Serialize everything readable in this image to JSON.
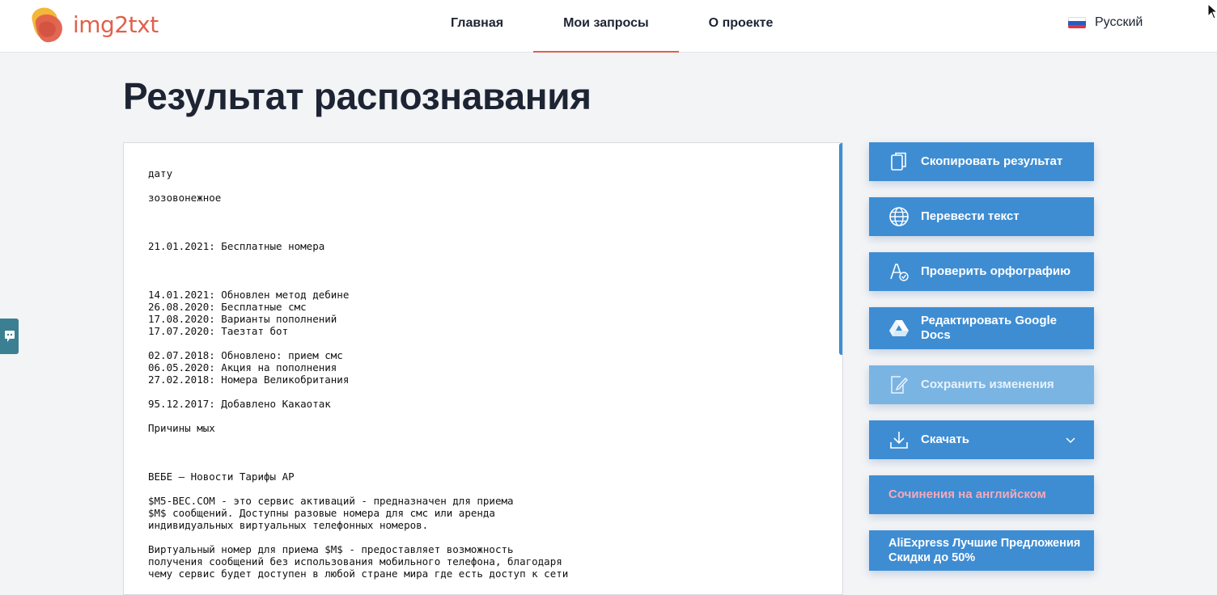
{
  "header": {
    "logo_text": "img2txt",
    "nav": [
      {
        "label": "Главная"
      },
      {
        "label": "Мои запросы"
      },
      {
        "label": "О проекте"
      }
    ],
    "language": "Русский"
  },
  "page": {
    "title": "Результат распознавания"
  },
  "result_text": "дату\n\nзозовонежное\n\n\n\n21.01.2021: Бесплатные номера\n\n\n\n14.01.2021: Обновлен метод дебине\n26.08.2020: Бесплатные смс\n17.08.2020: Варианты пополнений\n17.07.2020: Таезтат бот\n\n02.07.2018: Обновлено: прием смс\n06.05.2020: Акция на пополнения\n27.02.2018: Номера Великобритания\n\n95.12.2017: Добавлено Какаотак\n\nПричины мых\n\n\n\nВЕБЕ — Новости Тарифы АР\n\n$М5-ВЕС.СОМ - это сервис активаций - предназначен для приема\n$М$ сообщений. Доступны разовые номера для смс или аренда\nиндивидуальных виртуальных телефонных номеров.\n\nВиртуальный номер для приема $М$ - предоставляет возможность\nполучения сообщений без использования мобильного телефона, благодаря\nчему сервис будет доступен в любой стране мира где есть доступ к сети",
  "actions": {
    "copy": "Скопировать результат",
    "translate": "Перевести текст",
    "spellcheck": "Проверить орфографию",
    "google_docs": "Редактировать Google Docs",
    "save": "Сохранить изменения",
    "download": "Скачать",
    "ad1": "Сочинения на английском",
    "ad2": "AliExpress Лучшие Предложения Скидки до 50%"
  },
  "colors": {
    "accent": "#e0604c",
    "button": "#3e8dd3",
    "button_disabled": "#7ab4e2",
    "ad1_text": "#f6a9b8"
  }
}
